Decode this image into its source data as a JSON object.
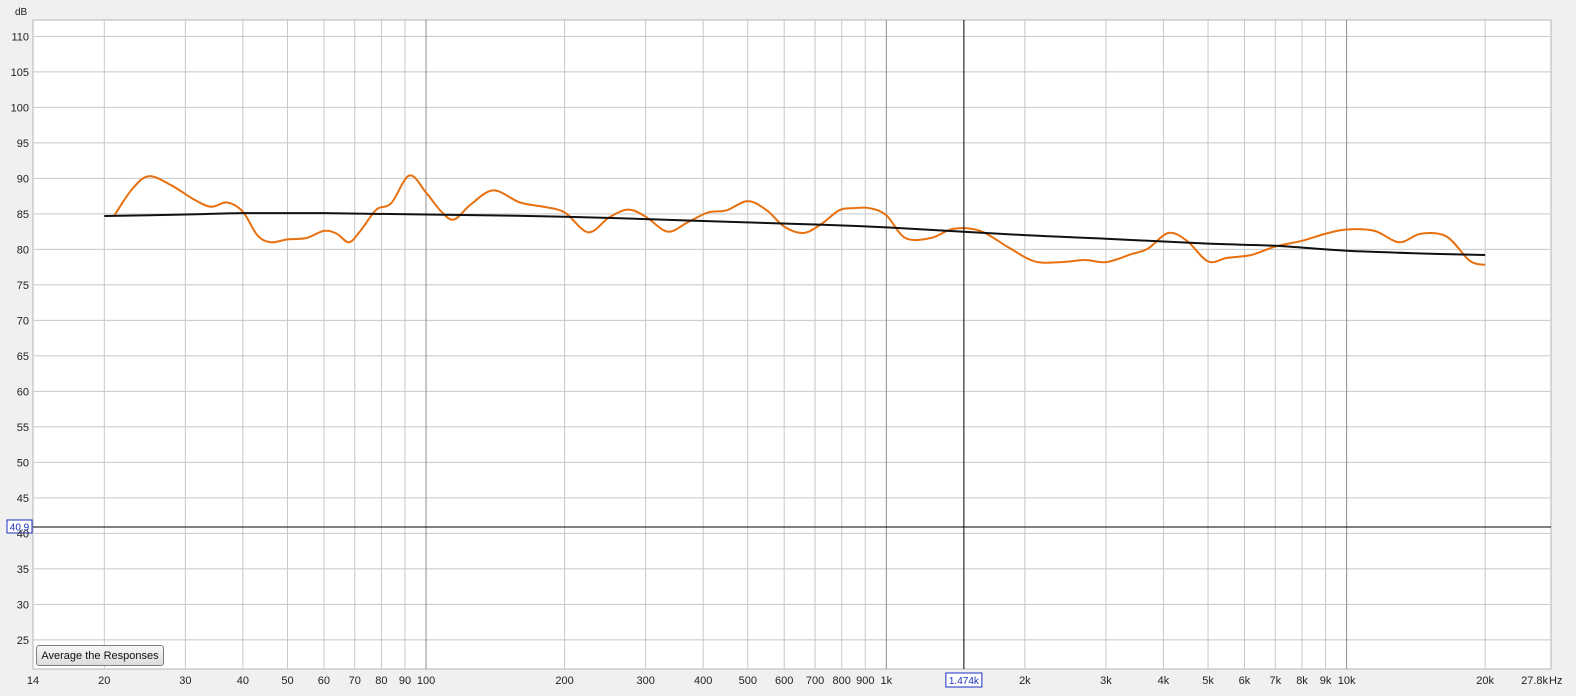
{
  "button": {
    "average_label": "Average the Responses"
  },
  "chart_data": {
    "type": "line",
    "xscale": "log",
    "ylabel": "dB",
    "x_unit_label": "Hz",
    "xlim": [
      14,
      27800
    ],
    "ylim": [
      20.9,
      112.3
    ],
    "grid": true,
    "x_ticks": [
      {
        "v": 14,
        "label": "14"
      },
      {
        "v": 20,
        "label": "20"
      },
      {
        "v": 30,
        "label": "30"
      },
      {
        "v": 40,
        "label": "40"
      },
      {
        "v": 50,
        "label": "50"
      },
      {
        "v": 60,
        "label": "60"
      },
      {
        "v": 70,
        "label": "70"
      },
      {
        "v": 80,
        "label": "80"
      },
      {
        "v": 90,
        "label": "90"
      },
      {
        "v": 100,
        "label": "100"
      },
      {
        "v": 200,
        "label": "200"
      },
      {
        "v": 300,
        "label": "300"
      },
      {
        "v": 400,
        "label": "400"
      },
      {
        "v": 500,
        "label": "500"
      },
      {
        "v": 600,
        "label": "600"
      },
      {
        "v": 700,
        "label": "700"
      },
      {
        "v": 800,
        "label": "800"
      },
      {
        "v": 900,
        "label": "900"
      },
      {
        "v": 1000,
        "label": "1k"
      },
      {
        "v": 2000,
        "label": "2k"
      },
      {
        "v": 3000,
        "label": "3k"
      },
      {
        "v": 4000,
        "label": "4k"
      },
      {
        "v": 5000,
        "label": "5k"
      },
      {
        "v": 6000,
        "label": "6k"
      },
      {
        "v": 7000,
        "label": "7k"
      },
      {
        "v": 8000,
        "label": "8k"
      },
      {
        "v": 9000,
        "label": "9k"
      },
      {
        "v": 10000,
        "label": "10k"
      },
      {
        "v": 20000,
        "label": "20k"
      },
      {
        "v": 27800,
        "label": "27.8k"
      }
    ],
    "y_ticks": [
      25,
      30,
      35,
      40,
      45,
      50,
      55,
      60,
      65,
      70,
      75,
      80,
      85,
      90,
      95,
      100,
      105,
      110
    ],
    "cursor": {
      "x": 1474,
      "x_label": "1.474k",
      "y": 40.9,
      "y_label": "40.9"
    },
    "series": [
      {
        "color": "#e8700f",
        "points": [
          [
            21,
            84.7
          ],
          [
            23,
            88.5
          ],
          [
            25,
            90.3
          ],
          [
            28,
            89.0
          ],
          [
            31,
            87.2
          ],
          [
            34,
            86.0
          ],
          [
            37,
            86.6
          ],
          [
            40,
            85.3
          ],
          [
            43,
            82.0
          ],
          [
            46,
            81.0
          ],
          [
            50,
            81.4
          ],
          [
            55,
            81.6
          ],
          [
            60,
            82.6
          ],
          [
            64,
            82.2
          ],
          [
            68,
            81.0
          ],
          [
            72,
            82.6
          ],
          [
            78,
            85.6
          ],
          [
            84,
            86.5
          ],
          [
            92,
            90.4
          ],
          [
            100,
            88.0
          ],
          [
            108,
            85.3
          ],
          [
            115,
            84.2
          ],
          [
            125,
            86.3
          ],
          [
            140,
            88.3
          ],
          [
            160,
            86.6
          ],
          [
            180,
            86.0
          ],
          [
            200,
            85.2
          ],
          [
            225,
            82.4
          ],
          [
            250,
            84.5
          ],
          [
            275,
            85.6
          ],
          [
            300,
            84.6
          ],
          [
            335,
            82.5
          ],
          [
            370,
            83.8
          ],
          [
            410,
            85.2
          ],
          [
            450,
            85.5
          ],
          [
            500,
            86.8
          ],
          [
            550,
            85.5
          ],
          [
            600,
            83.2
          ],
          [
            660,
            82.3
          ],
          [
            720,
            83.5
          ],
          [
            790,
            85.5
          ],
          [
            850,
            85.8
          ],
          [
            920,
            85.8
          ],
          [
            1000,
            84.8
          ],
          [
            1100,
            81.6
          ],
          [
            1250,
            81.6
          ],
          [
            1400,
            82.9
          ],
          [
            1600,
            82.6
          ],
          [
            1850,
            80.2
          ],
          [
            2100,
            78.3
          ],
          [
            2400,
            78.2
          ],
          [
            2700,
            78.5
          ],
          [
            3000,
            78.2
          ],
          [
            3400,
            79.3
          ],
          [
            3700,
            80.1
          ],
          [
            4100,
            82.3
          ],
          [
            4500,
            81.2
          ],
          [
            5000,
            78.3
          ],
          [
            5500,
            78.8
          ],
          [
            6200,
            79.2
          ],
          [
            7000,
            80.4
          ],
          [
            8000,
            81.2
          ],
          [
            9000,
            82.2
          ],
          [
            10000,
            82.8
          ],
          [
            11500,
            82.6
          ],
          [
            13000,
            81.0
          ],
          [
            14500,
            82.2
          ],
          [
            16500,
            81.8
          ],
          [
            18500,
            78.4
          ],
          [
            20000,
            77.8
          ]
        ]
      },
      {
        "color": "#111111",
        "points": [
          [
            20,
            84.7
          ],
          [
            30,
            84.9
          ],
          [
            40,
            85.1
          ],
          [
            60,
            85.1
          ],
          [
            100,
            84.9
          ],
          [
            200,
            84.6
          ],
          [
            400,
            84.0
          ],
          [
            700,
            83.5
          ],
          [
            1000,
            83.1
          ],
          [
            2000,
            82.0
          ],
          [
            3000,
            81.5
          ],
          [
            5000,
            80.8
          ],
          [
            7000,
            80.5
          ],
          [
            10000,
            79.8
          ],
          [
            15000,
            79.4
          ],
          [
            20000,
            79.2
          ]
        ]
      }
    ]
  }
}
